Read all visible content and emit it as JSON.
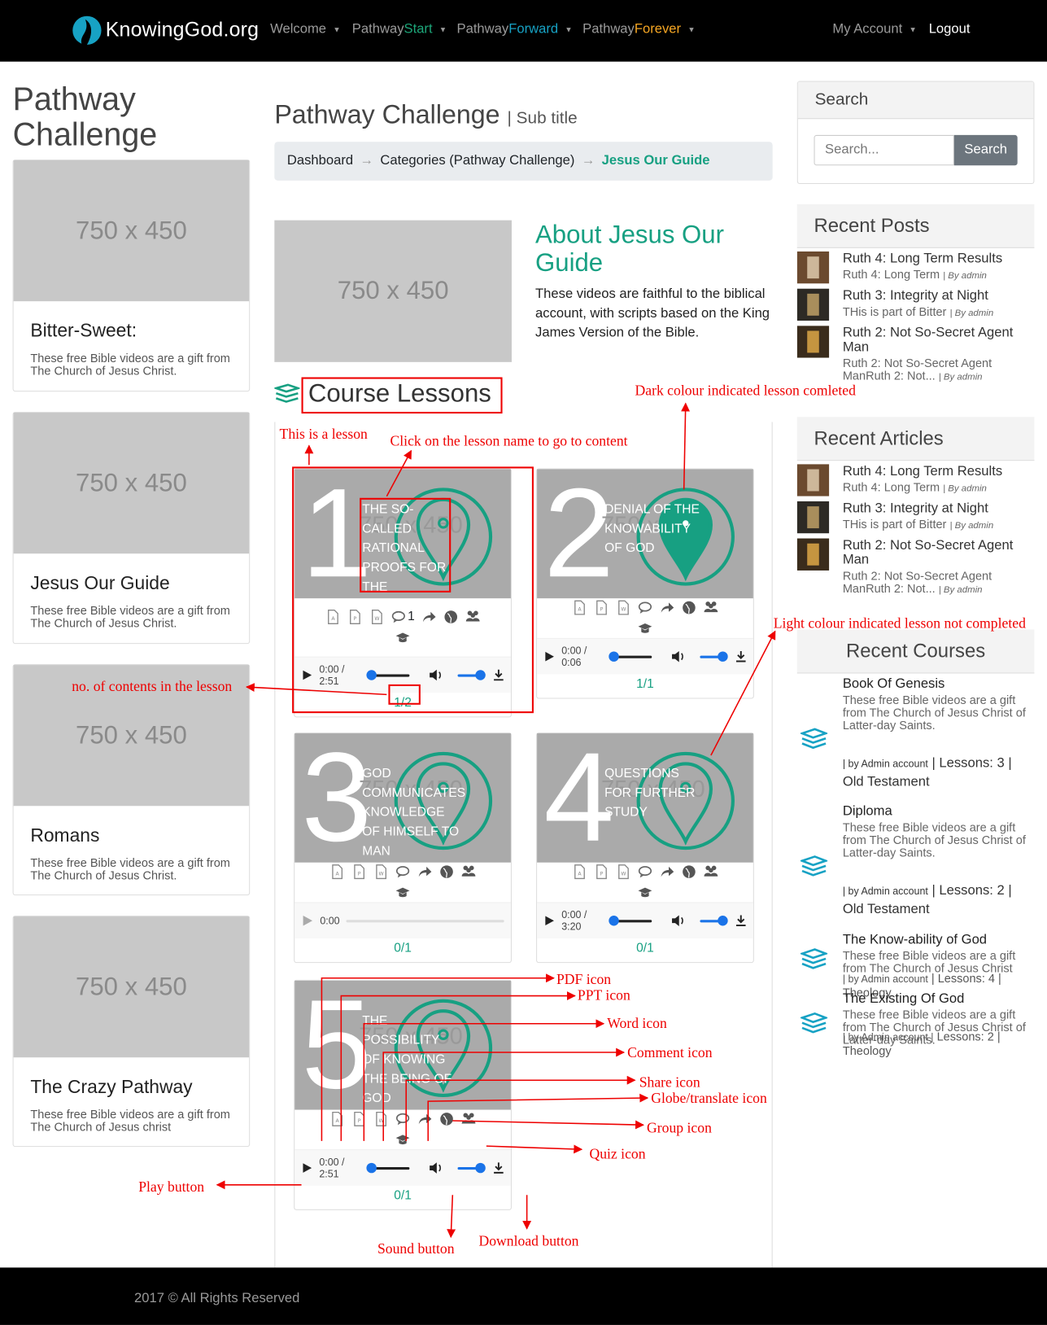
{
  "nav": {
    "brand": "KnowingGod.org",
    "items": [
      {
        "pre": "Welcome",
        "accent": "",
        "accent_color": ""
      },
      {
        "pre": "Pathway",
        "accent": "Start",
        "accent_color": "#1da77a"
      },
      {
        "pre": "Pathway",
        "accent": "Forward",
        "accent_color": "#17a2c4"
      },
      {
        "pre": "Pathway",
        "accent": "Forever",
        "accent_color": "#f5a623"
      }
    ],
    "account": "My Account",
    "logout": "Logout"
  },
  "sidebar": {
    "title": "Pathway Challenge",
    "cards": [
      {
        "placeholder": "750 x 450",
        "title": "Bitter-Sweet:",
        "text": "These free Bible videos are a gift from The Church of Jesus Christ."
      },
      {
        "placeholder": "750 x 450",
        "title": "Jesus Our Guide",
        "text": "These free Bible videos are a gift from The Church of Jesus Christ."
      },
      {
        "placeholder": "750 x 450",
        "title": "Romans",
        "text": "These free Bible videos are a gift from The Church of Jesus Christ."
      },
      {
        "placeholder": "750 x 450",
        "title": "The Crazy Pathway",
        "text": "These free Bible videos are a gift from The Church of Jesus christ"
      }
    ]
  },
  "main": {
    "title": "Pathway Challenge",
    "subtitle": "| Sub title",
    "breadcrumb": {
      "dashboard": "Dashboard",
      "sep": "→",
      "categories": "Categories",
      "categories_paren": "(Pathway Challenge)",
      "active": "Jesus Our Guide"
    },
    "about": {
      "placeholder": "750 x 450",
      "title": "About Jesus Our Guide",
      "text": "These videos are faithful to the biblical account, with scripts based on the King James Version of the Bible."
    },
    "lessons_title": "Course Lessons",
    "lessons": [
      {
        "num": "1",
        "title": "THE SO-CALLED RATIONAL PROOFS FOR THE EXISTENCE OF GOD",
        "placeholder": "750 x 450",
        "comments": "1",
        "time": "0:00 / 2:51",
        "count": "1/2",
        "completed": false
      },
      {
        "num": "2",
        "title": "DENIAL OF THE KNOWABILITY OF GOD",
        "placeholder": "750 x 450",
        "comments": "",
        "time": "0:00 / 0:06",
        "count": "1/1",
        "completed": true
      },
      {
        "num": "3",
        "title": "GOD COMMUNICATES KNOWLEDGE OF HIMSELF TO MAN",
        "placeholder": "750 x 450",
        "comments": "",
        "time": "0:00",
        "count": "0/1",
        "completed": false
      },
      {
        "num": "4",
        "title": "QUESTIONS FOR FURTHER STUDY",
        "placeholder": "750 x 450",
        "comments": "",
        "time": "0:00 / 3:20",
        "count": "0/1",
        "completed": false
      },
      {
        "num": "5",
        "title": "THE POSSIBILITY OF KNOWING THE BEING OF GOD",
        "placeholder": "750 x 450",
        "comments": "",
        "time": "0:00 / 2:51",
        "count": "0/1",
        "completed": false
      }
    ]
  },
  "right": {
    "search": {
      "title": "Search",
      "placeholder": "Search...",
      "button": "Search"
    },
    "recent_posts": {
      "title": "Recent Posts",
      "items": [
        {
          "title": "Ruth 4: Long Term Results",
          "sub": "Ruth 4: Long Term",
          "by": "| By admin"
        },
        {
          "title": "Ruth 3: Integrity at Night",
          "sub": "THis is part of Bitter",
          "by": "| By admin"
        },
        {
          "title": "Ruth 2: Not So-Secret Agent Man",
          "sub": "Ruth 2: Not So-Secret Agent ManRuth 2: Not...",
          "by": "| By admin"
        }
      ]
    },
    "recent_articles": {
      "title": "Recent Articles",
      "items": [
        {
          "title": "Ruth 4: Long Term Results",
          "sub": "Ruth 4: Long Term",
          "by": "| By admin"
        },
        {
          "title": "Ruth 3: Integrity at Night",
          "sub": "THis is part of Bitter",
          "by": "| By admin"
        },
        {
          "title": "Ruth 2: Not So-Secret Agent Man",
          "sub": "Ruth 2: Not So-Secret Agent ManRuth 2: Not...",
          "by": "| By admin"
        }
      ]
    },
    "recent_courses": {
      "title": "Recent Courses",
      "items": [
        {
          "title": "Book Of Genesis",
          "desc": "These free Bible videos are a gift from The Church of Jesus Christ of Latter-day Saints.",
          "by": "| by Admin account",
          "lessons": "| Lessons: 3 |",
          "category": "Old Testament"
        },
        {
          "title": "Diploma",
          "desc": "These free Bible videos are a gift from The Church of Jesus Christ of Latter-day Saints.",
          "by": "| by Admin account",
          "lessons": "| Lessons: 2 |",
          "category": "Old Testament"
        },
        {
          "title": "The Know-ability of God",
          "desc": "These free Bible videos are a gift from The Church of Jesus Christ",
          "by": "| by Admin account",
          "lessons": "| Lessons: 4 | Theology",
          "category": ""
        },
        {
          "title": "The Existing Of God",
          "desc": "These free Bible videos are a gift from The Church of Jesus Christ of Latter-day Saints.",
          "by": "| by Admin account |",
          "lessons": "Lessons: 2 | Theology",
          "category": ""
        }
      ]
    }
  },
  "footer": "2017 © All Rights Reserved",
  "annotations": {
    "this_is_lesson": "This is a lesson",
    "click_name": "Click on the lesson name to go to content",
    "dark_colour": "Dark colour indicated lesson comleted",
    "light_colour": "Light colour indicated lesson not completed",
    "no_contents": "no. of contents in the lesson",
    "pdf": "PDF icon",
    "ppt": "PPT icon",
    "word": "Word icon",
    "comment": "Comment icon",
    "share": "Share icon",
    "globe": "Globe/translate icon",
    "group": "Group icon",
    "quiz": "Quiz icon",
    "play": "Play button",
    "sound": "Sound button",
    "download": "Download button"
  },
  "colors": {
    "accent": "#17a082",
    "annotation": "#e00000"
  }
}
